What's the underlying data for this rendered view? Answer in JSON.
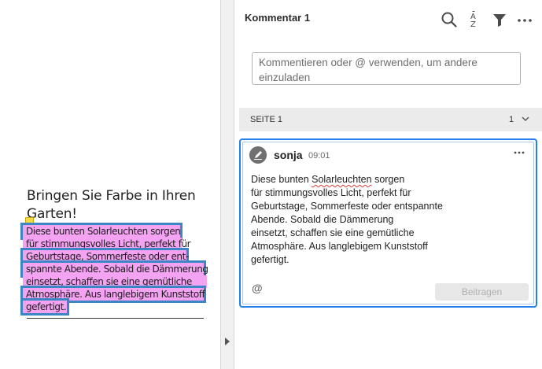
{
  "document": {
    "heading_lines": [
      "Bringen Sie Farbe in Ihren",
      "Garten!"
    ],
    "paragraph_lines": [
      "Diese bunten Solarleuchten sorgen",
      "für stimmungsvolles Licht, perfekt für",
      "Geburtstage, Sommerfeste oder ent-",
      "spannte Abende. Sobald die Dämmerung",
      "einsetzt, schaffen sie eine gemütliche",
      "Atmosphäre. Aus langlebigem Kunststoff",
      "gefertigt."
    ],
    "highlight_color": "#f4a3f2",
    "selection_color": "#3d86c6"
  },
  "panel": {
    "title": "Kommentar 1",
    "icons": [
      "search-icon",
      "sort-az-icon",
      "filter-icon",
      "more-icon"
    ],
    "input_placeholder": "Kommentieren oder @ verwenden, um andere einzuladen",
    "page_label": "SEITE 1",
    "page_comment_count": "1"
  },
  "comment": {
    "author": "sonja",
    "time": "09:01",
    "body_lines": [
      "Diese bunten Solarleuchten sorgen",
      "für stimmungsvolles Licht, perfekt für",
      "Geburtstage, Sommerfeste oder entspannte",
      "Abende. Sobald die Dämmerung",
      "einsetzt, schaffen sie eine gemütliche",
      "Atmosphäre. Aus langlebigem Kunststoff",
      "gefertigt."
    ],
    "misspelled_word": "Solarleuchten",
    "mention_symbol": "@",
    "submit_label": "Beitragen",
    "accent_color": "#2680eb"
  }
}
